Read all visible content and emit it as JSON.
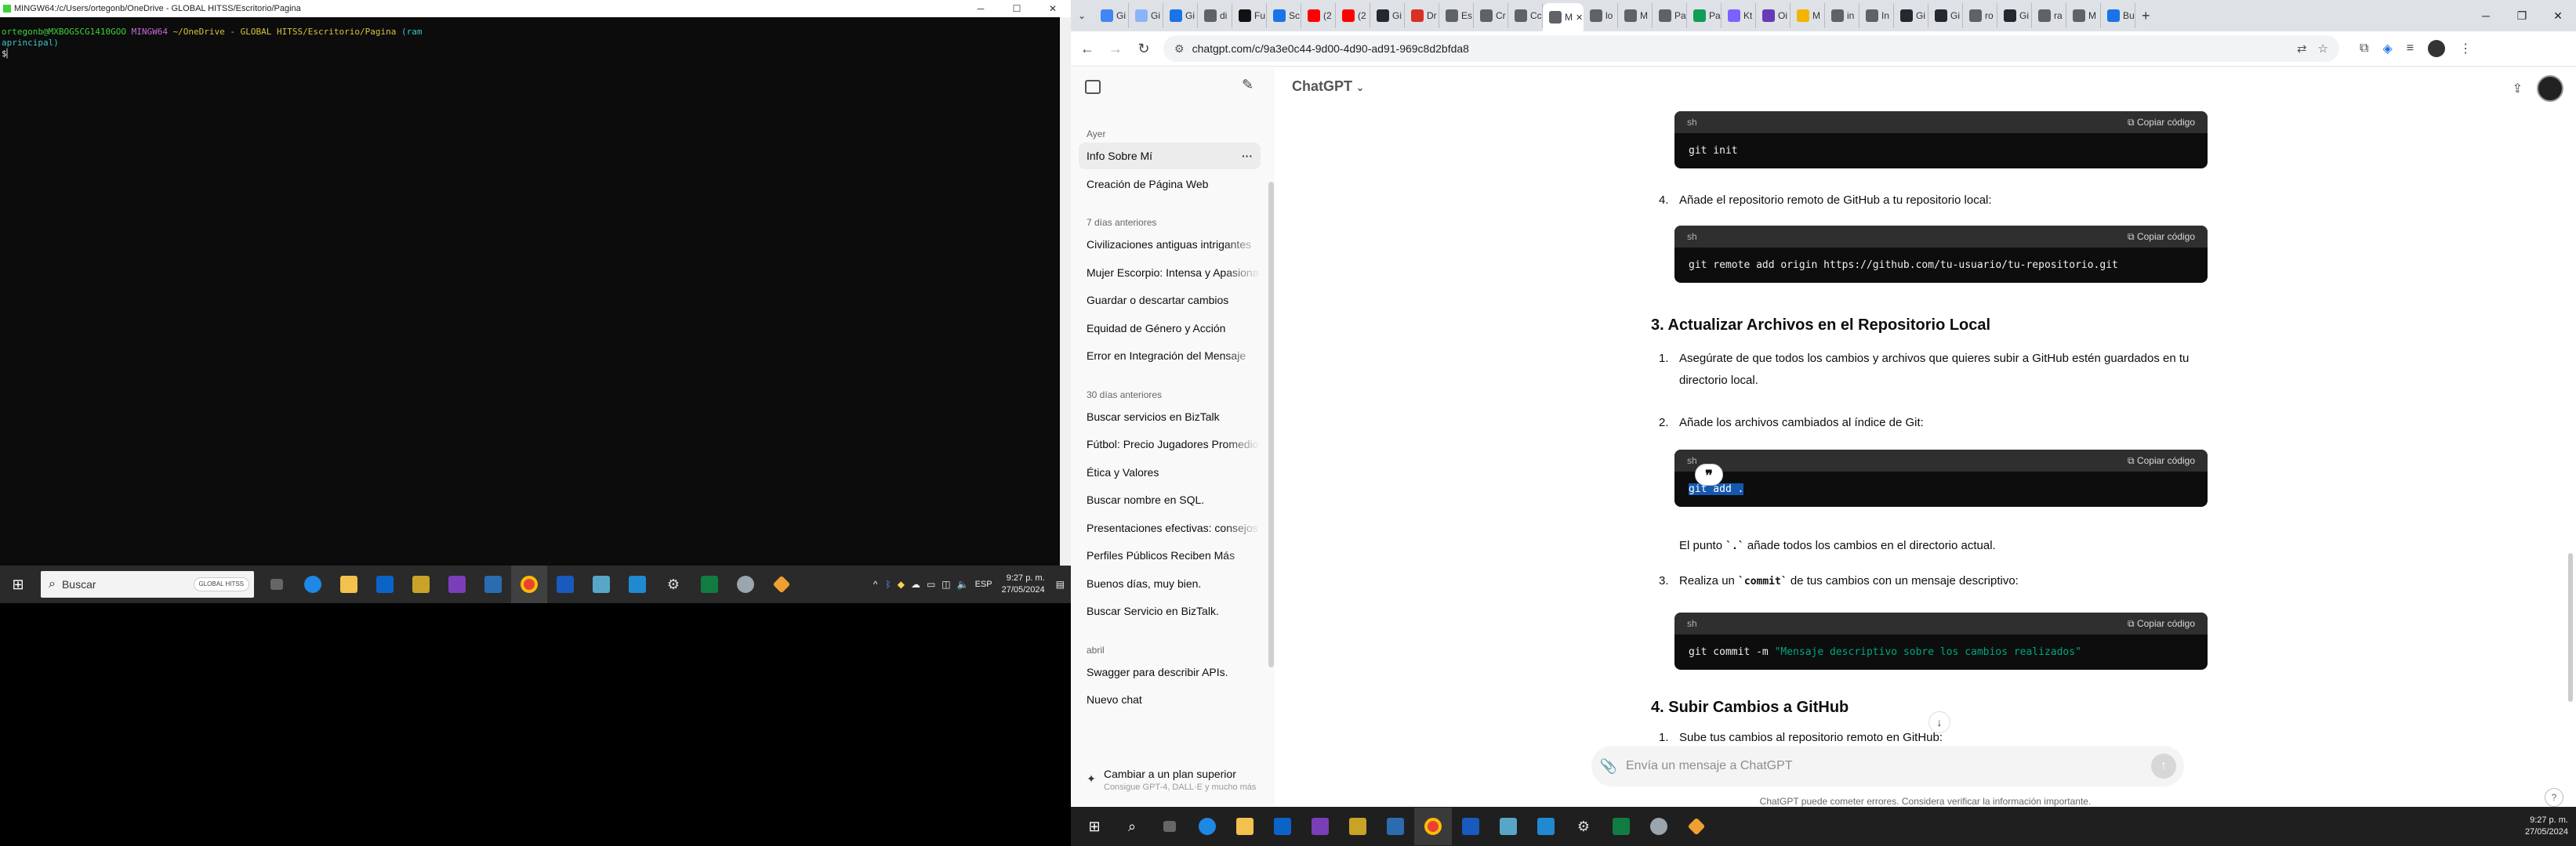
{
  "terminal": {
    "title": "MINGW64:/c/Users/ortegonb/OneDrive - GLOBAL HITSS/Escritorio/Pagina",
    "prompt_user": "ortegonb@MXBOGSCG1410GOO",
    "prompt_shell": "MINGW64",
    "prompt_path": "~/OneDrive - GLOBAL HITSS/Escritorio/Pagina",
    "prompt_branch_a": "(ram",
    "prompt_branch_b": "aprincipal)",
    "prompt_symbol": "$"
  },
  "left_taskbar": {
    "search_placeholder": "Buscar",
    "search_badge": "GLOBAL HITSS",
    "lang": "ESP",
    "time": "9:27 p. m.",
    "date": "27/05/2024"
  },
  "browser": {
    "tabs": [
      {
        "label": "Gi brt",
        "color": "#4285f4"
      },
      {
        "label": "Gi",
        "color": "#8ab4f8"
      },
      {
        "label": "Gi",
        "color": "#1a73e8"
      },
      {
        "label": "di",
        "color": "#5f6368"
      },
      {
        "label": "Fu",
        "color": "#111111"
      },
      {
        "label": "Sc",
        "color": "#1a73e8"
      },
      {
        "label": "(2",
        "color": "#ff0000"
      },
      {
        "label": "(2",
        "color": "#ff0000"
      },
      {
        "label": "Gi",
        "color": "#24292f"
      },
      {
        "label": "Dr",
        "color": "#d93025"
      },
      {
        "label": "Es",
        "color": "#5f6368"
      },
      {
        "label": "Cr",
        "color": "#5f6368"
      },
      {
        "label": "Cc",
        "color": "#5f6368"
      },
      {
        "label": "M",
        "color": "#5f6368"
      },
      {
        "label": "lo",
        "color": "#5f6368"
      },
      {
        "label": "M",
        "color": "#5f6368"
      },
      {
        "label": "Pa",
        "color": "#5f6368"
      },
      {
        "label": "Pa",
        "color": "#0f9d58"
      },
      {
        "label": "Kt",
        "color": "#7b61ff"
      },
      {
        "label": "Oi",
        "color": "#673ab7"
      },
      {
        "label": "M",
        "color": "#f4b400"
      },
      {
        "label": "in",
        "color": "#5f6368"
      },
      {
        "label": "In",
        "color": "#5f6368"
      },
      {
        "label": "Gi",
        "color": "#24292f"
      },
      {
        "label": "Gi",
        "color": "#24292f"
      },
      {
        "label": "ro",
        "color": "#5f6368"
      },
      {
        "label": "Gi",
        "color": "#24292f"
      },
      {
        "label": "ra",
        "color": "#5f6368"
      },
      {
        "label": "M",
        "color": "#5f6368"
      },
      {
        "label": "Bu",
        "color": "#1a73e8"
      }
    ],
    "active_tab_index": 13,
    "url": "chatgpt.com/c/9a3e0c44-9d00-4d90-ad91-969c8d2bfda8"
  },
  "sidebar": {
    "sections": [
      {
        "title": "Ayer",
        "items": [
          "Info Sobre Mí",
          "Creación de Página Web"
        ]
      },
      {
        "title": "7 días anteriores",
        "items": [
          "Civilizaciones antiguas intrigantes",
          "Mujer Escorpio: Intensa y Apasionada",
          "Guardar o descartar cambios",
          "Equidad de Género y Acción",
          "Error en Integración del Mensaje"
        ]
      },
      {
        "title": "30 días anteriores",
        "items": [
          "Buscar servicios en BizTalk",
          "Fútbol: Precio Jugadores Promedio",
          "Ética y Valores",
          "Buscar nombre en SQL.",
          "Presentaciones efectivas: consejos",
          "Perfiles Públicos Reciben Más",
          "Buenos días, muy bien.",
          "Buscar Servicio en BizTalk."
        ]
      },
      {
        "title": "abril",
        "items": [
          "Swagger para describir APIs.",
          "Nuevo chat"
        ]
      }
    ],
    "upgrade_title": "Cambiar a un plan superior",
    "upgrade_sub": "Consigue GPT-4, DALL·E y mucho más"
  },
  "main": {
    "model": "ChatGPT",
    "blocks": {
      "code1": {
        "lang": "sh",
        "copy": "Copiar código",
        "code": "git init"
      },
      "step4": {
        "num": "4.",
        "text": "Añade el repositorio remoto de GitHub a tu repositorio local:"
      },
      "code2": {
        "lang": "sh",
        "copy": "Copiar código",
        "code": "git remote add origin https://github.com/tu-usuario/tu-repositorio.git"
      },
      "h3_update": "3. Actualizar Archivos en el Repositorio Local",
      "u1": {
        "num": "1.",
        "text": "Asegúrate de que todos los cambios y archivos que quieres subir a GitHub estén guardados en tu directorio local."
      },
      "u2": {
        "num": "2.",
        "text": "Añade los archivos cambiados al índice de Git:"
      },
      "code3": {
        "lang": "sh",
        "copy": "Copiar código",
        "code": "git add ."
      },
      "para_a": "El punto ",
      "para_code": "`.`",
      "para_b": " añade todos los cambios en el directorio actual.",
      "u3_a": "Realiza un ",
      "u3_code": "`commit`",
      "u3_b": " de tus cambios con un mensaje descriptivo:",
      "u3_num": "3.",
      "code4": {
        "lang": "sh",
        "copy": "Copiar código",
        "cmd": "git commit -m ",
        "str": "\"Mensaje descriptivo sobre los cambios realizados\""
      },
      "h3_upload": "4. Subir Cambios a GitHub",
      "s1": {
        "num": "1.",
        "text": "Sube tus cambios al repositorio remoto en GitHub:"
      }
    },
    "composer_placeholder": "Envía un mensaje a ChatGPT",
    "disclaimer": "ChatGPT puede cometer errores. Considera verificar la información importante.",
    "help": "?"
  },
  "right_taskbar": {
    "time": "9:27 p. m.",
    "date": "27/05/2024"
  }
}
